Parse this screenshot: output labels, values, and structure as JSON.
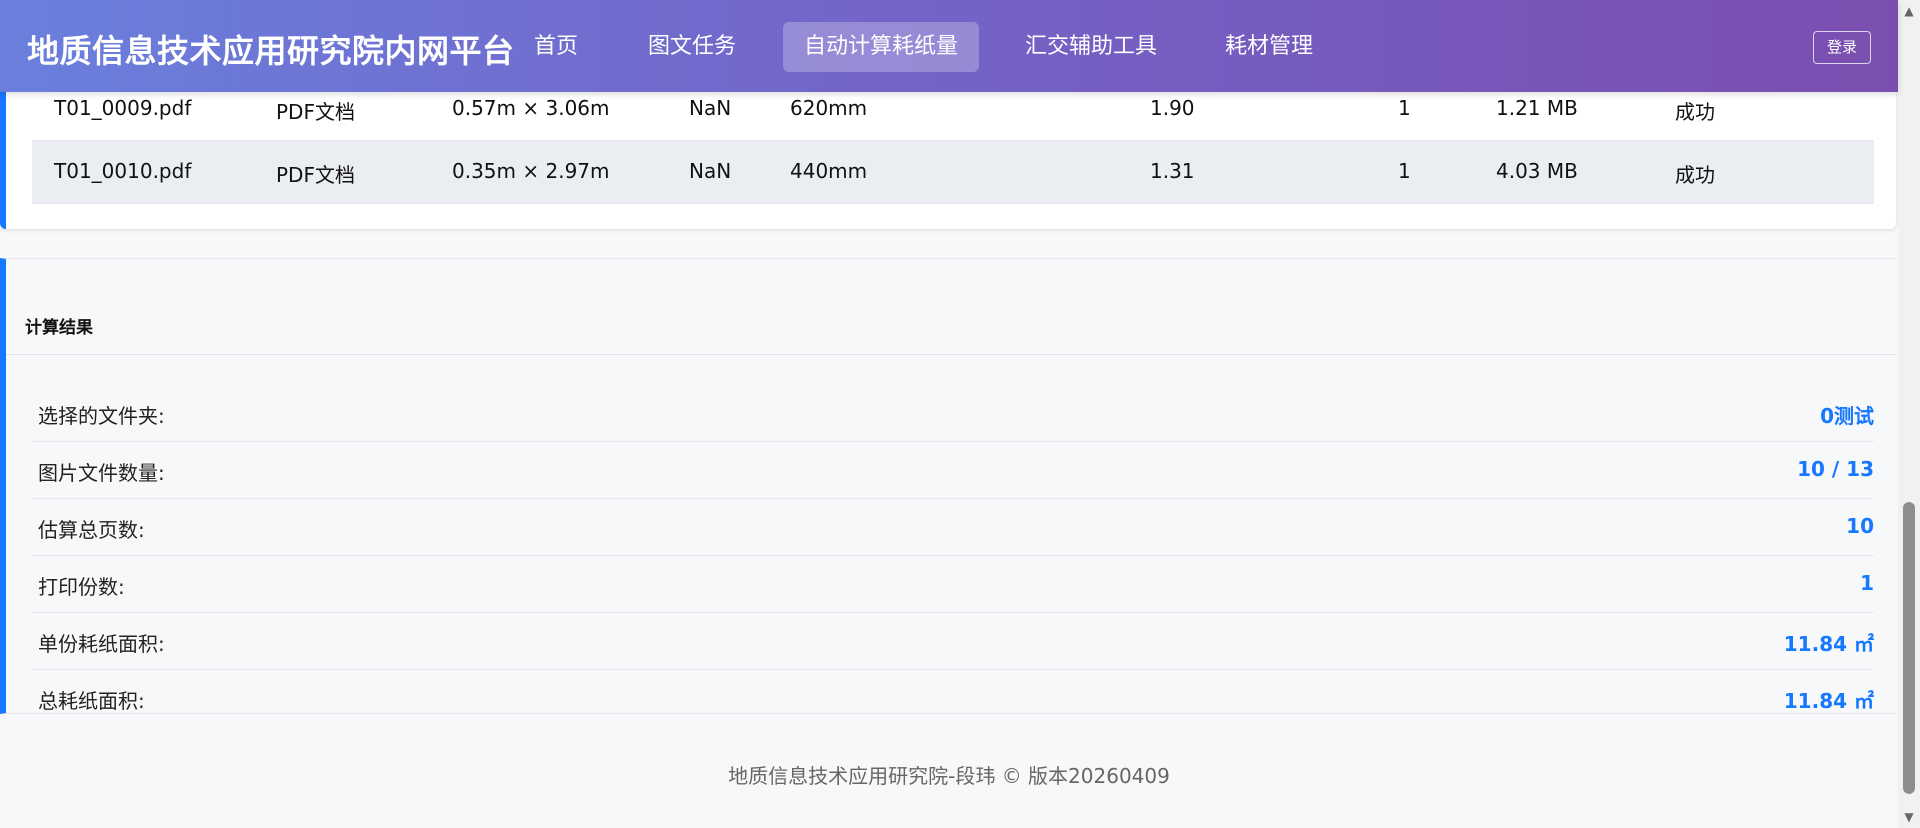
{
  "header": {
    "brand": "地质信息技术应用研究院内网平台",
    "nav": [
      {
        "label": "首页"
      },
      {
        "label": "图文任务"
      },
      {
        "label": "自动计算耗纸量"
      },
      {
        "label": "汇交辅助工具"
      },
      {
        "label": "耗材管理"
      }
    ],
    "active_nav": "自动计算耗纸量",
    "login_label": "登录"
  },
  "files": {
    "rows": [
      {
        "name": "T01_0009.pdf",
        "type": "PDF文档",
        "size": "0.57m × 3.06m",
        "dpi": "NaN",
        "width": "620mm",
        "area": "1.90",
        "copies": "1",
        "filesize": "1.21 MB",
        "status": "成功"
      },
      {
        "name": "T01_0010.pdf",
        "type": "PDF文档",
        "size": "0.35m × 2.97m",
        "dpi": "NaN",
        "width": "440mm",
        "area": "1.31",
        "copies": "1",
        "filesize": "4.03 MB",
        "status": "成功"
      }
    ]
  },
  "result": {
    "title": "计算结果",
    "items": [
      {
        "label": "选择的文件夹:",
        "value": "0测试"
      },
      {
        "label": "图片文件数量:",
        "value": "10 / 13"
      },
      {
        "label": "估算总页数:",
        "value": "10"
      },
      {
        "label": "打印份数:",
        "value": "1"
      },
      {
        "label": "单份耗纸面积:",
        "value": "11.84 ㎡"
      },
      {
        "label": "总耗纸面积:",
        "value": "11.84 ㎡"
      }
    ]
  },
  "footer": {
    "text": "地质信息技术应用研究院-段玮 © 版本20260409"
  },
  "colors": {
    "accent": "#1677ff",
    "header_gradient_start": "#6a7fdc",
    "header_gradient_end": "#7a4fb0"
  },
  "icons": {
    "scroll_up": "triangle-up-icon",
    "scroll_down": "triangle-down-icon"
  }
}
